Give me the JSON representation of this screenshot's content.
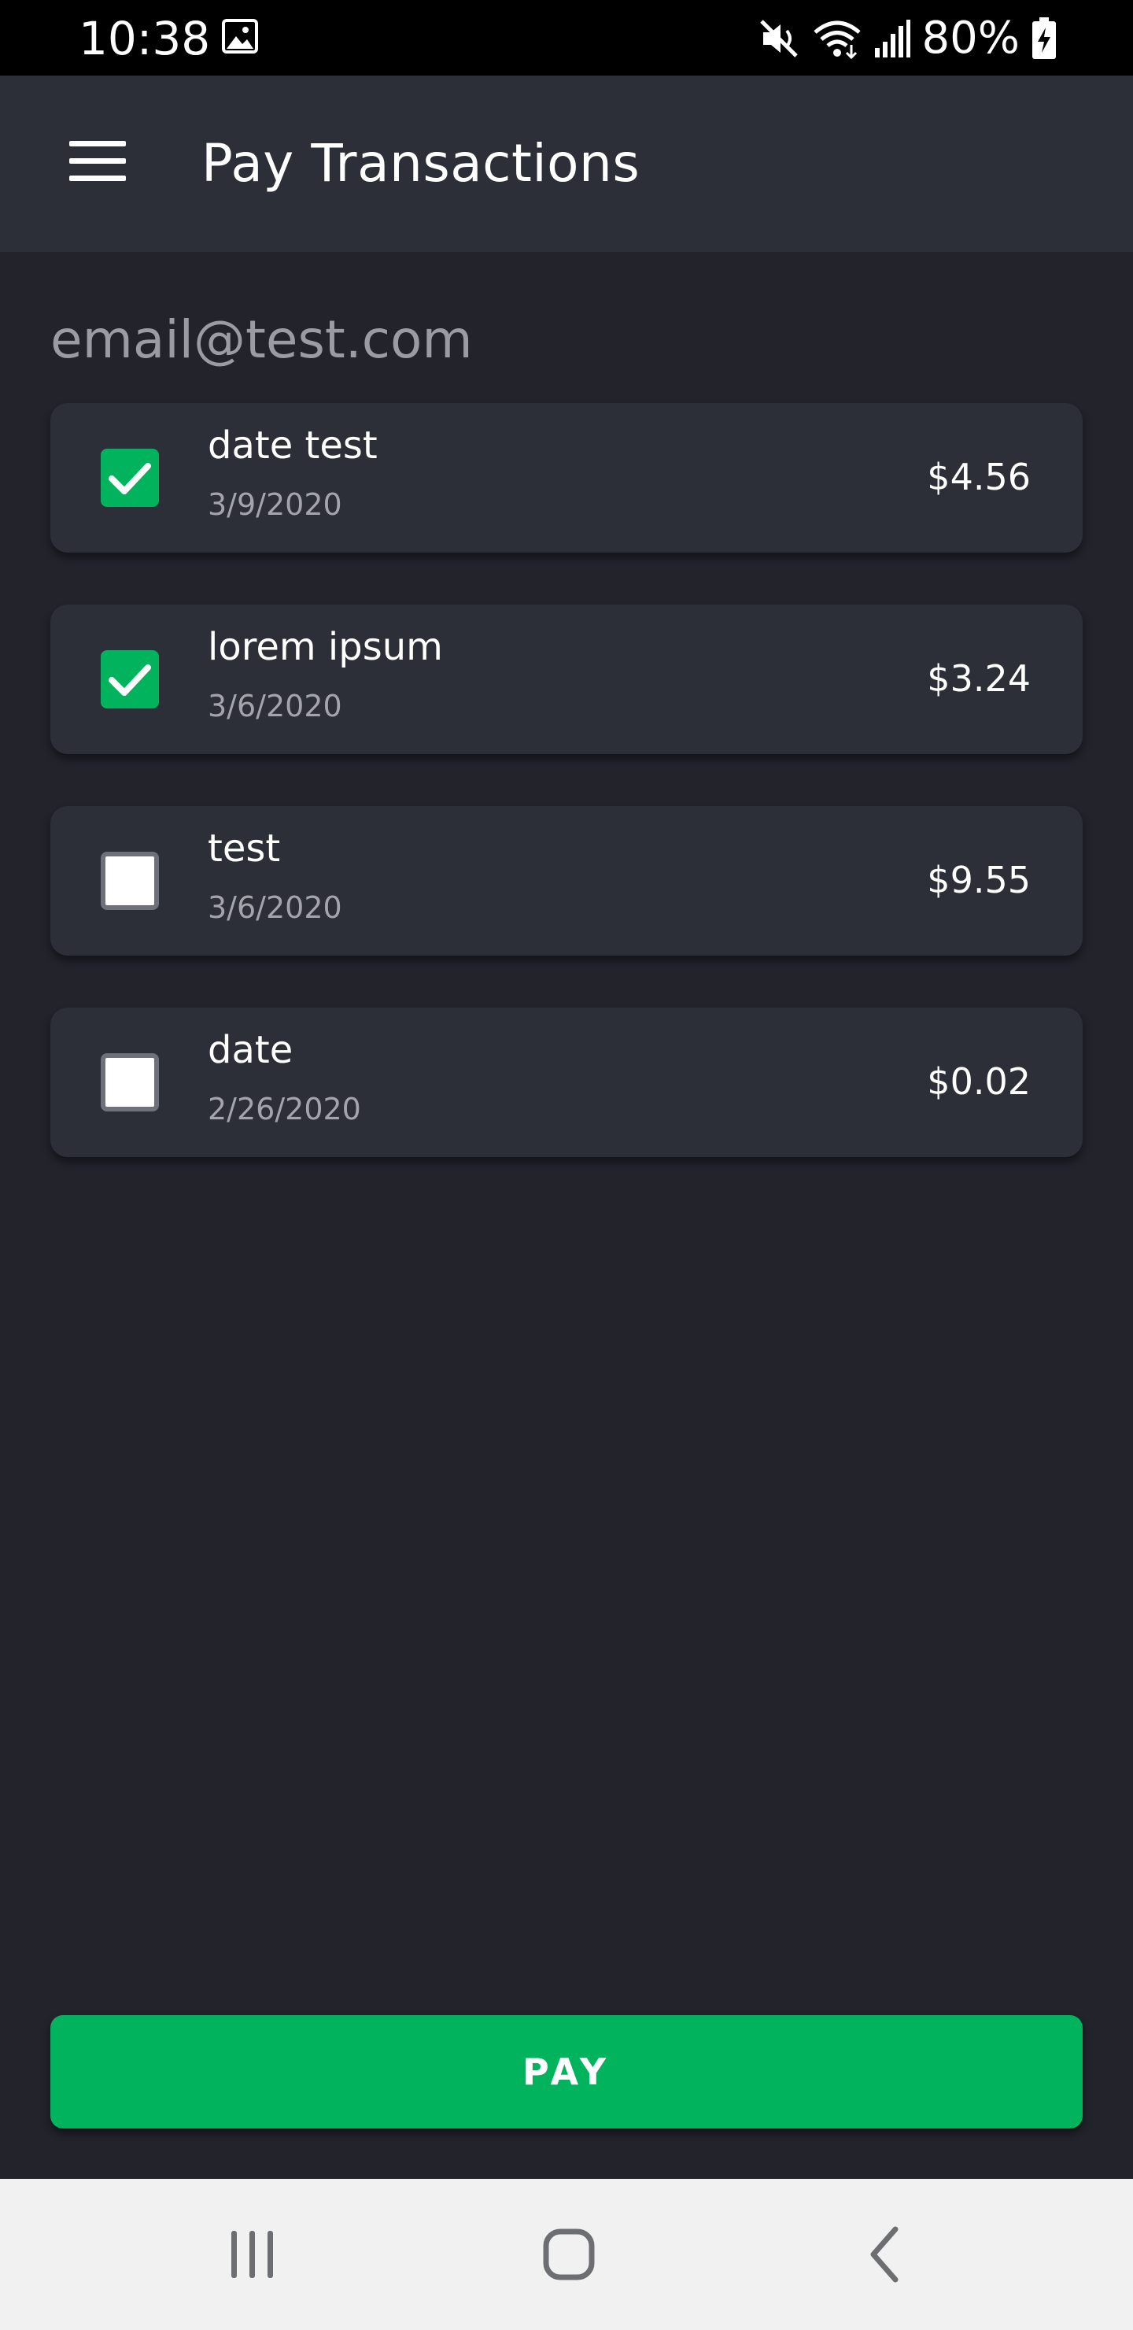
{
  "status_bar": {
    "time": "10:38",
    "battery_percent": "80%",
    "icons": [
      "photo-icon",
      "mute-icon",
      "wifi-icon",
      "signal-icon",
      "battery-charging-icon"
    ]
  },
  "app_bar": {
    "menu_icon": "hamburger-menu-icon",
    "title": "Pay Transactions"
  },
  "account": {
    "email": "email@test.com"
  },
  "transactions": [
    {
      "name": "date test",
      "date": "3/9/2020",
      "amount": "$4.56",
      "checked": true
    },
    {
      "name": "lorem ipsum",
      "date": "3/6/2020",
      "amount": "$3.24",
      "checked": true
    },
    {
      "name": "test",
      "date": "3/6/2020",
      "amount": "$9.55",
      "checked": false
    },
    {
      "name": "date",
      "date": "2/26/2020",
      "amount": "$0.02",
      "checked": false
    }
  ],
  "pay_button": {
    "label": "PAY"
  },
  "nav_bar": {
    "items": [
      "recents-icon",
      "home-icon",
      "back-icon"
    ]
  },
  "colors": {
    "background": "#22232b",
    "surface": "#2d2f38",
    "accent": "#00b35c",
    "text_primary": "#ffffff",
    "text_secondary": "#a3a5ab",
    "nav_bar": "#f1f1f1"
  }
}
